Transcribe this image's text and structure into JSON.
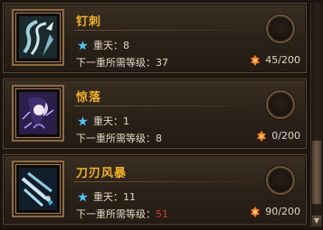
{
  "skills": [
    {
      "name": "钉刺",
      "layer_label": "重天：8",
      "requirement_prefix": "下一重所需等级：",
      "requirement_level": "37",
      "requirement_insufficient": false,
      "cost": "45/200",
      "icon": "spike-skill-icon"
    },
    {
      "name": "惊落",
      "layer_label": "重天：1",
      "requirement_prefix": "下一重所需等级：",
      "requirement_level": "8",
      "requirement_insufficient": false,
      "cost": "0/200",
      "icon": "startle-skill-icon"
    },
    {
      "name": "刀刃风暴",
      "layer_label": "重天：11",
      "requirement_prefix": "下一重所需等级：",
      "requirement_level": "51",
      "requirement_insufficient": true,
      "cost": "90/200",
      "icon": "blade-storm-skill-icon"
    }
  ],
  "colors": {
    "skill_name": "#f0b12a",
    "text": "#e2d6c0",
    "insufficient": "#d23a2a",
    "star": "#4fc3ff",
    "flame": "#ff7a1a"
  },
  "scrollbar": {
    "down_arrow": "▼"
  }
}
